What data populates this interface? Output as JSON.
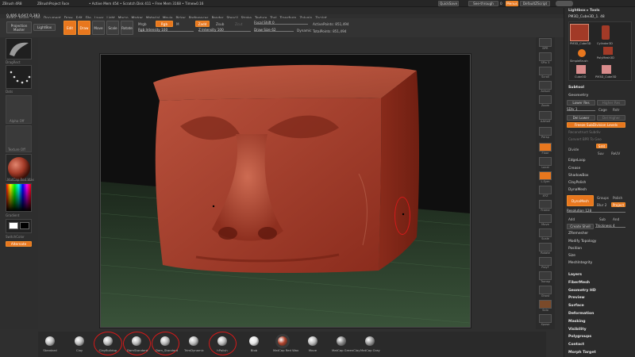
{
  "titlebar": {
    "app": "ZBrush 4R8",
    "project": "ZBrushProject Face",
    "stats": "• Active Mem 454 • Scratch Disk 411 • Free Mem 3168 • Timer▸0.16",
    "quicksave": "QuickSave",
    "seethrough": "See-through",
    "seethrough_val": "0",
    "menus_btn": "Menus",
    "script_btn": "DefaultZScript"
  },
  "menubar": {
    "items": [
      "Alpha",
      "Brush",
      "Color",
      "Document",
      "Draw",
      "Edit",
      "File",
      "Layer",
      "Light",
      "Macro",
      "Marker",
      "Material",
      "Movie",
      "Picker",
      "Preferences",
      "Render",
      "Stencil",
      "Stroke",
      "Texture",
      "Tool",
      "Transform",
      "Zplugin",
      "Zscript"
    ]
  },
  "coords": "0.406,0.647,0.383",
  "topshelf": {
    "projection_master": "Projection Master",
    "lightbox": "LightBox",
    "edit": "Edit",
    "draw": "Draw",
    "move": "Move",
    "scale": "Scale",
    "rotate": "Rotate",
    "mrgb": "Mrgb",
    "rgb": "Rgb",
    "m": "M",
    "rgb_intensity": "Rgb Intensity 100",
    "zadd": "Zadd",
    "zsub": "Zsub",
    "zcut": "Zcut",
    "z_intensity": "Z Intensity 100",
    "focal_shift": "Focal Shift 0",
    "draw_size": "Draw Size 62",
    "dynamic": "Dynamic",
    "active_points": "ActivePoints: 851,494",
    "total_points": "TotalPoints: 851,494"
  },
  "leftshelf": {
    "labels": [
      "DragRect",
      "Dots",
      "Alpha Off",
      "Texture Off",
      "MatCap Red Wax"
    ],
    "gradient": "Gradient",
    "switchcolor": "SwitchColor",
    "alternate": "Alternate"
  },
  "rightshelf": {
    "labels": [
      "BPR",
      "SPix 3",
      "Scroll",
      "Actual",
      "Zoom",
      "AAHalf",
      "Persp",
      "Floor",
      "Local",
      "L.Sym",
      "XYZ",
      "Frame",
      "Move",
      "Scale",
      "Rotate",
      "PolyF",
      "Transp",
      "Ghost",
      "Solo",
      "Xpose"
    ]
  },
  "tray": {
    "lightbox_tools": "Lightbox ▸ Tools",
    "tool_name": "PM3D_Cube3D_1. 48",
    "tool_slots": [
      "PM3D_Cube3D",
      "Cylinder3D",
      "PolyMesh3D",
      "SimpleBrush",
      "Cube3D",
      "PM3D_Cube3D"
    ],
    "subtool": "Subtool",
    "geometry": "Geometry",
    "lower_res": "Lower Res",
    "higher_res": "Higher Res",
    "sdiv": "SDiv 1",
    "cage": "Cage",
    "rstr": "Rstr",
    "del_lower": "Del Lower",
    "del_higher": "Del Higher",
    "freeze_subdivision": "Freeze SubDivision Levels",
    "reconstruct_subdiv": "Reconstruct Subdiv",
    "convert_bpr": "Convert BPR To Geo",
    "divide": "Divide",
    "smt": "Smt",
    "suv": "Suv",
    "reuv": "ReUV",
    "edgeloop": "EdgeLoop",
    "crease": "Crease",
    "shadowbox": "ShadowBox",
    "claypolish": "ClayPolish",
    "dynamesh_section": "DynaMesh",
    "dynamesh_btn": "DynaMesh",
    "groups": "Groups",
    "polish": "Polish",
    "blur": "Blur 2",
    "project": "Project",
    "resolution": "Resolution 128",
    "add": "Add",
    "sub": "Sub",
    "and": "And",
    "create_shell": "Create Shell",
    "thickness": "Thickness 4",
    "zremesher": "ZRemesher",
    "modify_topology": "Modify Topology",
    "position": "Position",
    "size": "Size",
    "meshintegrity": "MeshIntegrity",
    "sections": [
      "Layers",
      "FiberMesh",
      "Geometry HD",
      "Preview",
      "Surface",
      "Deformation",
      "Masking",
      "Visibility",
      "Polygroups",
      "Contact",
      "Morph Target"
    ]
  },
  "brushes": [
    "Standard",
    "Clay",
    "ClayBuildup",
    "DamStandard",
    "Dam_Standard",
    "TrimDynamic",
    "hPolish",
    "Blob",
    "MatCap Red Wax",
    "Move",
    "MatCap GreenClay",
    "MatCap Gray"
  ],
  "colors": {
    "accent": "#e8771e",
    "annotation": "#d51a1a",
    "wax": "#a23a27"
  }
}
